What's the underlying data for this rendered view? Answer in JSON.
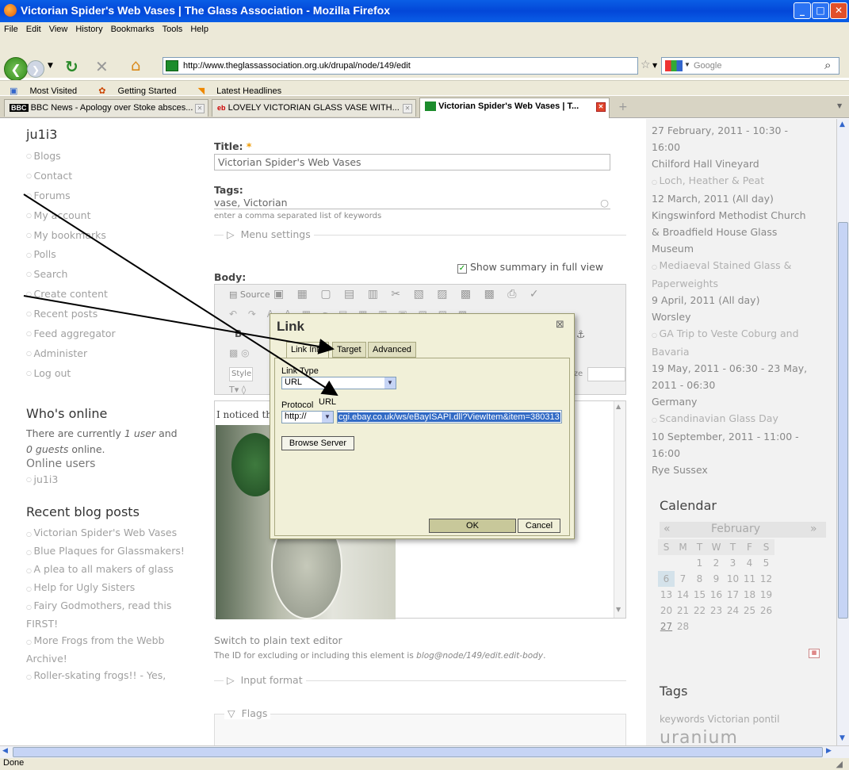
{
  "window": {
    "title": "Victorian Spider's Web Vases | The Glass Association - Mozilla Firefox"
  },
  "menu": [
    "File",
    "Edit",
    "View",
    "History",
    "Bookmarks",
    "Tools",
    "Help"
  ],
  "nav": {
    "url": "http://www.theglassassociation.org.uk/drupal/node/149/edit",
    "search_placeholder": "Google"
  },
  "bookmarks": [
    "Most Visited",
    "Getting Started",
    "Latest Headlines"
  ],
  "tabs": [
    {
      "label": "BBC News - Apology over Stoke absces..."
    },
    {
      "label": "LOVELY VICTORIAN GLASS VASE WITH..."
    },
    {
      "label": "Victorian Spider's Web Vases | T..."
    }
  ],
  "sidebar": {
    "user": "ju1i3",
    "items": [
      "Blogs",
      "Contact",
      "Forums",
      "My account",
      "My bookmarks",
      "Polls",
      "Search",
      "Create content",
      "Recent posts",
      "Feed aggregator",
      "Administer",
      "Log out"
    ],
    "whos_online_title": "Who's online",
    "online_text_a": "There are currently ",
    "online_users_count": "1 user",
    "online_text_b": " and",
    "online_guests": "0 guests",
    "online_text_c": " online.",
    "online_users_label": "Online users",
    "online_user": "ju1i3",
    "recent_title": "Recent blog posts",
    "recent": [
      "Victorian Spider's Web Vases",
      "Blue Plaques for Glassmakers!",
      "A plea to all makers of glass",
      "Help for Ugly Sisters",
      "Fairy Godmothers, read this FIRST!",
      "More Frogs from the Webb Archive!",
      "Roller-skating frogs!! - Yes,"
    ]
  },
  "form": {
    "title_label": "Title:",
    "required_mark": "*",
    "title_value": "Victorian Spider's Web Vases",
    "tags_label": "Tags:",
    "tags_value": "vase, Victorian",
    "tags_hint": "enter a comma separated list of keywords",
    "menu_settings": "Menu settings",
    "summary_label": "Show summary in full view",
    "body_label": "Body:",
    "source_label": "Source",
    "style_label": "Style",
    "size_label": "ize",
    "body_text": "I noticed th",
    "switch_editor": "Switch to plain text editor",
    "id_note_a": "The ID for excluding or including this element is ",
    "id_note_b": "blog@node/149/edit.edit-body",
    "id_note_c": ".",
    "input_format": "Input format",
    "flags": "Flags"
  },
  "dialog": {
    "title": "Link",
    "tabs": [
      "Link Info",
      "Target",
      "Advanced"
    ],
    "link_type_label": "Link Type",
    "link_type_value": "URL",
    "protocol_label": "Protocol",
    "protocol_value": "http://",
    "url_label": "URL",
    "url_value": "cgi.ebay.co.uk/ws/eBayISAPI.dll?ViewItem&item=380313",
    "browse": "Browse Server",
    "ok": "OK",
    "cancel": "Cancel"
  },
  "events": [
    {
      "date": "27 February, 2011 - 10:30 - 16:00",
      "place": "Chilford Hall Vineyard"
    },
    {
      "title": "Loch, Heather & Peat",
      "date": "12 March, 2011 (All day)",
      "place": "Kingswinford Methodist Church & Broadfield House Glass Museum"
    },
    {
      "title": "Mediaeval Stained Glass & Paperweights",
      "date": "9 April, 2011 (All day)",
      "place": "Worsley"
    },
    {
      "title": "GA Trip to Veste Coburg and Bavaria",
      "date": "19 May, 2011 - 06:30 - 23 May, 2011 - 06:30",
      "place": "Germany"
    },
    {
      "title": "Scandinavian Glass Day",
      "date": "10 September, 2011 - 11:00 - 16:00",
      "place": "Rye Sussex"
    }
  ],
  "calendar": {
    "title": "Calendar",
    "month": "February",
    "prev": "«",
    "next": "»",
    "days": [
      "S",
      "M",
      "T",
      "W",
      "T",
      "F",
      "S"
    ],
    "weeks": [
      [
        "",
        "",
        "1",
        "2",
        "3",
        "4",
        "5"
      ],
      [
        "6",
        "7",
        "8",
        "9",
        "10",
        "11",
        "12"
      ],
      [
        "13",
        "14",
        "15",
        "16",
        "17",
        "18",
        "19"
      ],
      [
        "20",
        "21",
        "22",
        "23",
        "24",
        "25",
        "26"
      ],
      [
        "27",
        "28",
        "",
        "",
        "",
        "",
        ""
      ]
    ]
  },
  "tags_block": {
    "title": "Tags",
    "line": "keywords Victorian pontil",
    "big": "uranium"
  },
  "status": "Done"
}
